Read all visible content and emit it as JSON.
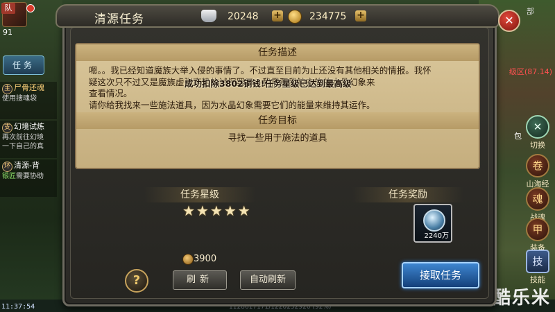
{
  "hud": {
    "team_tag": "队",
    "player_level": "91",
    "task_tab": "任务",
    "right_top": "部",
    "map_level": "级区(87.14)",
    "bag": "包",
    "clock": "11:37:54",
    "bottom_coords": "1128617171/1220252920 (92%)",
    "watermark": "酷乐米"
  },
  "quest_list": [
    {
      "badge": "主",
      "title": "尸骨还魂",
      "sub": "使用搜魂袋"
    },
    {
      "badge": "支",
      "title": "幻境试炼",
      "sub": "再次前往幻境",
      "sub2": "一下自己的真"
    },
    {
      "badge": "环",
      "title": "清源-背",
      "sub_hl": "银匠",
      "sub": "需要协助"
    }
  ],
  "right_buttons": [
    {
      "id": "switch",
      "label": "切换",
      "icon": "swap-icon",
      "glyph": "✕"
    },
    {
      "id": "shanhaijing",
      "label": "山海经",
      "icon": "book-icon",
      "glyph": "卷"
    },
    {
      "id": "zhanhun",
      "label": "战魂",
      "icon": "soul-icon",
      "glyph": "魂"
    },
    {
      "id": "zhuangbei",
      "label": "装备",
      "icon": "armor-icon",
      "glyph": "甲"
    },
    {
      "id": "jineng",
      "label": "技能",
      "icon": "skill-icon",
      "glyph": "技"
    }
  ],
  "dialog": {
    "title": "清源任务",
    "silver": "20248",
    "gold": "234775",
    "close": "✕",
    "desc_head": "任务描述",
    "desc_lines": [
      "嗯。。我已经知道魔族大举入侵的事情了。不过直至目前为止还没有其他相关的情报。我怀",
      "疑这次只不过又是魔族虚张声势的试探罢了。我需要我鲛衣族的水晶幻象来",
      "查看情况。",
      "请你给我找来一些施法道具，因为水晶幻象需要它们的能量来维持其运作。"
    ],
    "overlay_msg": "成功扣除3802铜钱!任务星级已达到最高级",
    "goal_head": "任务目标",
    "goal": "寻找一些用于施法的道具",
    "star_head": "任务星级",
    "stars": "★★★★★",
    "reward_head": "任务奖励",
    "reward_qty": "2240万",
    "cost": "3900",
    "help": "?",
    "refresh": "刷新",
    "auto_refresh": "自动刷新",
    "accept": "接取任务"
  }
}
